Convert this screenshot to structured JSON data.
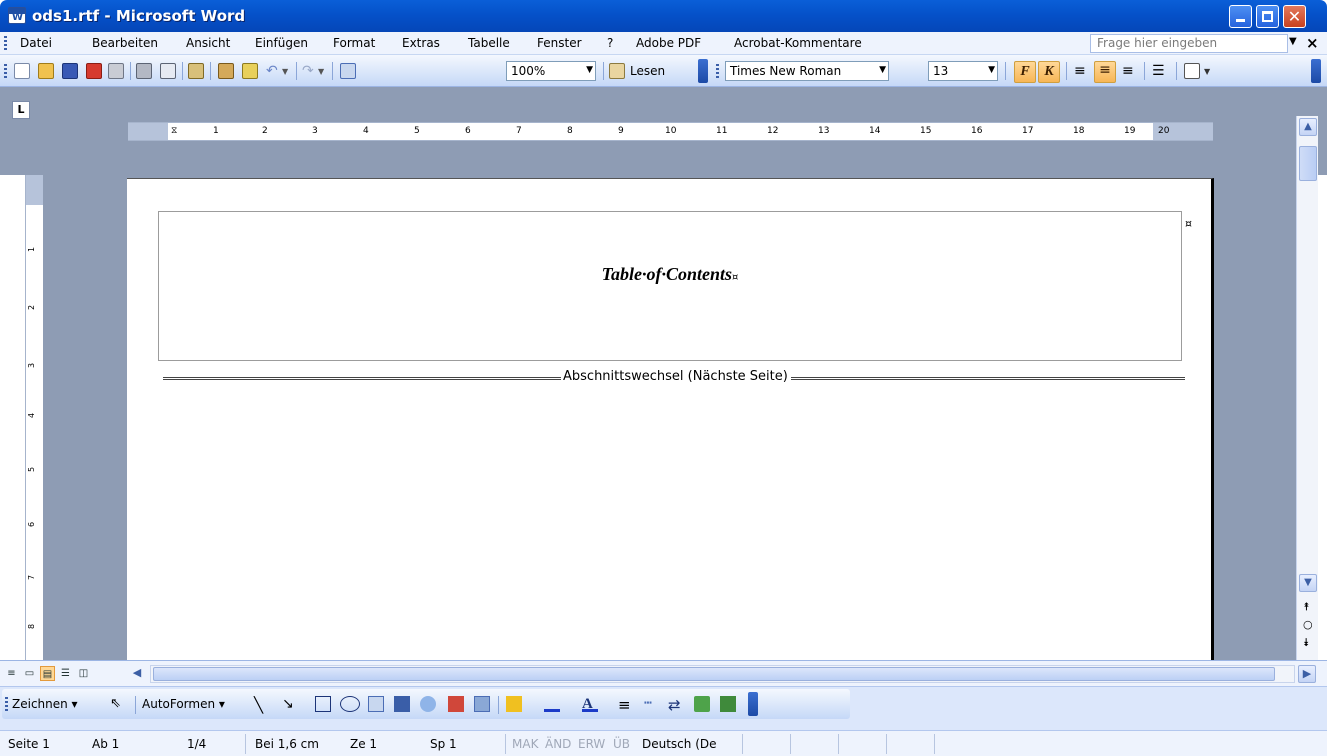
{
  "window": {
    "title": "ods1.rtf - Microsoft Word"
  },
  "menubar": {
    "items": [
      "Datei",
      "Bearbeiten",
      "Ansicht",
      "Einfügen",
      "Format",
      "Extras",
      "Tabelle",
      "Fenster",
      "?",
      "Adobe PDF",
      "Acrobat-Kommentare"
    ],
    "help_placeholder": "Frage hier eingeben"
  },
  "toolbar": {
    "zoom": "100%",
    "read_label": "Lesen",
    "font_name": "Times New Roman",
    "font_size": "13",
    "bold_label": "F",
    "italic_label": "K"
  },
  "ruler": {
    "labels": [
      "1",
      "2",
      "3",
      "4",
      "5",
      "6",
      "7",
      "8",
      "9",
      "10",
      "11",
      "12",
      "13",
      "14",
      "15",
      "16",
      "17",
      "18",
      "19",
      "20"
    ],
    "vertical_labels": [
      "1",
      "2",
      "3",
      "4",
      "5",
      "6",
      "7",
      "8"
    ]
  },
  "document": {
    "heading": "Table·of·Contents",
    "cell_mark": "¤",
    "section_break": "Abschnittswechsel (Nächste Seite)"
  },
  "drawbar": {
    "draw_label": "Zeichnen",
    "autoshapes_label": "AutoFormen"
  },
  "statusbar": {
    "page": "Seite 1",
    "section": "Ab 1",
    "pages": "1/4",
    "position": "Bei 1,6 cm",
    "line": "Ze 1",
    "column": "Sp 1",
    "mak": "MAK",
    "aend": "ÄND",
    "erw": "ERW",
    "ueb": "ÜB",
    "language": "Deutsch (De"
  }
}
